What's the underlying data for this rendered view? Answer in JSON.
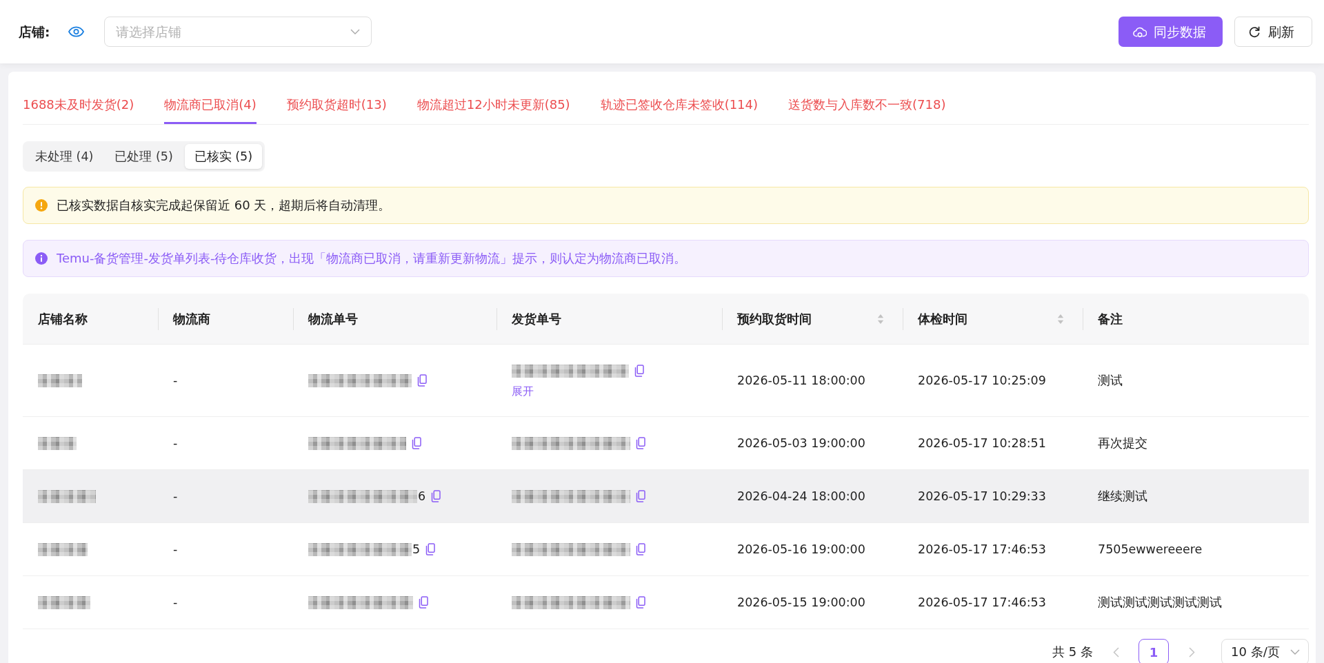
{
  "toolbar": {
    "store_label": "店铺:",
    "store_select": {
      "placeholder": "请选择店铺"
    },
    "buttons": [
      {
        "kind": "sync",
        "label": "同步数据"
      },
      {
        "kind": "refresh",
        "label": "刷新"
      }
    ]
  },
  "tabs": [
    {
      "label": "1688未及时发货(2)",
      "selected": false
    },
    {
      "label": "物流商已取消(4)",
      "selected": true
    },
    {
      "label": "预约取货超时(13)",
      "selected": false
    },
    {
      "label": "物流超过12小时未更新(85)",
      "selected": false
    },
    {
      "label": "轨迹已签收仓库未签收(114)",
      "selected": false
    },
    {
      "label": "送货数与入库数不一致(718)",
      "selected": false
    }
  ],
  "status_filter": [
    {
      "label": "未处理 (4)",
      "selected": false
    },
    {
      "label": "已处理 (5)",
      "selected": false
    },
    {
      "label": "已核实 (5)",
      "selected": true
    }
  ],
  "alerts": [
    {
      "kind": "warning",
      "text": "已核实数据自核实完成起保留近 60 天，超期后将自动清理。"
    },
    {
      "kind": "info",
      "text": "Temu-备货管理-发货单列表-待仓库收货，出现「物流商已取消，请重新更新物流」提示，则认定为物流商已取消。"
    }
  ],
  "table": {
    "columns": [
      {
        "label": "店铺名称",
        "sortable": false
      },
      {
        "label": "物流商",
        "sortable": false
      },
      {
        "label": "物流单号",
        "sortable": false
      },
      {
        "label": "发货单号",
        "sortable": false
      },
      {
        "label": "预约取货时间",
        "sortable": true
      },
      {
        "label": "体检时间",
        "sortable": true
      },
      {
        "label": "备注",
        "sortable": false
      }
    ],
    "rows": [
      {
        "carrier": "-",
        "shipment_expand_link": "展开",
        "pickup_time": "2026-05-11 18:00:00",
        "check_time": "2026-05-17 10:25:09",
        "remark": "测试",
        "hovered": false
      },
      {
        "carrier": "-",
        "pickup_time": "2026-05-03 19:00:00",
        "check_time": "2026-05-17 10:28:51",
        "remark": "再次提交",
        "hovered": false
      },
      {
        "carrier": "-",
        "tracking_no_tail": "6",
        "pickup_time": "2026-04-24 18:00:00",
        "check_time": "2026-05-17 10:29:33",
        "remark": "继续测试",
        "hovered": true
      },
      {
        "carrier": "-",
        "tracking_no_tail": "5",
        "pickup_time": "2026-05-16 19:00:00",
        "check_time": "2026-05-17 17:46:53",
        "remark": "7505ewwereeere",
        "hovered": false
      },
      {
        "carrier": "-",
        "pickup_time": "2026-05-15 19:00:00",
        "check_time": "2026-05-17 17:46:53",
        "remark": "测试测试测试测试测试",
        "hovered": false
      }
    ]
  },
  "pagination": {
    "total": "共 5 条",
    "prev_disabled": true,
    "pages": [
      {
        "label": "1",
        "selected": true
      }
    ],
    "next_disabled": true,
    "page_size": "10 条/页"
  }
}
